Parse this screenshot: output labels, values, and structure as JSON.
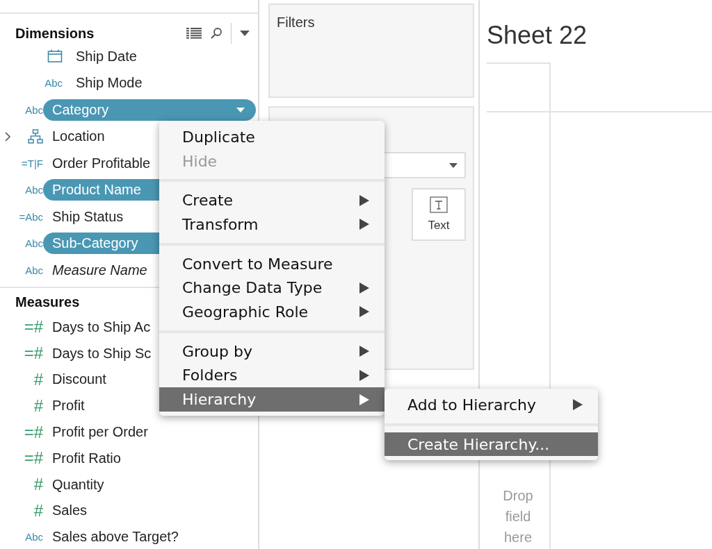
{
  "data_pane": {
    "dimensions": {
      "title": "Dimensions",
      "fields": [
        {
          "name": "Ship Date",
          "kind": "date",
          "selected": false,
          "italic": false,
          "indent": true
        },
        {
          "name": "Ship Mode",
          "kind": "text",
          "type_icon": "Abc",
          "selected": false,
          "italic": false,
          "indent": true
        },
        {
          "name": "Category",
          "kind": "text",
          "type_icon": "Abc",
          "selected": true,
          "italic": false,
          "indent": false,
          "menu_open": true
        },
        {
          "name": "Location",
          "kind": "hierarchy",
          "selected": false,
          "italic": false,
          "indent": false,
          "expanded": false
        },
        {
          "name": "Order Profitable",
          "kind": "text",
          "type_icon": "=T|F",
          "selected": false,
          "italic": false,
          "indent": false
        },
        {
          "name": "Product Name",
          "kind": "text",
          "type_icon": "Abc",
          "selected": true,
          "italic": false,
          "indent": false
        },
        {
          "name": "Ship Status",
          "kind": "text",
          "type_icon": "=Abc",
          "selected": false,
          "italic": false,
          "indent": false
        },
        {
          "name": "Sub-Category",
          "kind": "text",
          "type_icon": "Abc",
          "selected": true,
          "italic": false,
          "indent": false
        },
        {
          "name": "Measure Name",
          "kind": "text",
          "type_icon": "Abc",
          "selected": false,
          "italic": true,
          "indent": false
        }
      ]
    },
    "measures": {
      "title": "Measures",
      "fields": [
        {
          "name": "Days to Ship Ac",
          "kind": "number",
          "type_icon": "=#"
        },
        {
          "name": "Days to Ship Sc",
          "kind": "number",
          "type_icon": "=#"
        },
        {
          "name": "Discount",
          "kind": "number",
          "type_icon": "#"
        },
        {
          "name": "Profit",
          "kind": "number",
          "type_icon": "#"
        },
        {
          "name": "Profit per Order",
          "kind": "number",
          "type_icon": "=#"
        },
        {
          "name": "Profit Ratio",
          "kind": "number",
          "type_icon": "=#"
        },
        {
          "name": "Quantity",
          "kind": "number",
          "type_icon": "#"
        },
        {
          "name": "Sales",
          "kind": "number",
          "type_icon": "#"
        },
        {
          "name": "Sales above Target?",
          "kind": "text",
          "type_icon": "Abc"
        }
      ]
    }
  },
  "filters": {
    "title": "Filters"
  },
  "marks": {
    "buttons": [
      {
        "label": "Text"
      }
    ]
  },
  "sheet": {
    "title": "Sheet 22",
    "drop_hint": "Drop field here"
  },
  "context_menu": {
    "sections": [
      [
        {
          "label": "Duplicate",
          "disabled": false,
          "submenu": false,
          "selected": false
        },
        {
          "label": "Hide",
          "disabled": true,
          "submenu": false,
          "selected": false
        }
      ],
      [
        {
          "label": "Create",
          "disabled": false,
          "submenu": true,
          "selected": false
        },
        {
          "label": "Transform",
          "disabled": false,
          "submenu": true,
          "selected": false
        }
      ],
      [
        {
          "label": "Convert to Measure",
          "disabled": false,
          "submenu": false,
          "selected": false
        },
        {
          "label": "Change Data Type",
          "disabled": false,
          "submenu": true,
          "selected": false
        },
        {
          "label": "Geographic Role",
          "disabled": false,
          "submenu": true,
          "selected": false
        }
      ],
      [
        {
          "label": "Group by",
          "disabled": false,
          "submenu": true,
          "selected": false
        },
        {
          "label": "Folders",
          "disabled": false,
          "submenu": true,
          "selected": false
        },
        {
          "label": "Hierarchy",
          "disabled": false,
          "submenu": true,
          "selected": true
        }
      ]
    ]
  },
  "submenu": {
    "sections": [
      [
        {
          "label": "Add to Hierarchy",
          "disabled": false,
          "submenu": true,
          "selected": false
        }
      ],
      [
        {
          "label": "Create Hierarchy...",
          "disabled": false,
          "submenu": false,
          "selected": true
        }
      ]
    ]
  }
}
